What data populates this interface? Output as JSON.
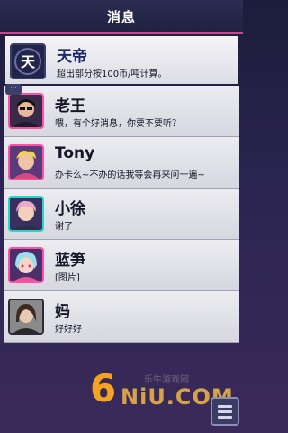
{
  "header": {
    "title": "消息"
  },
  "contacts": [
    {
      "name": "天帝",
      "message": "超出部分按100币/吨计算。",
      "avatar": "tiandi-logo-icon"
    },
    {
      "name": "老王",
      "message": "喂，有个好消息，你要不要听？",
      "avatar": "laowang-avatar",
      "badge": "···"
    },
    {
      "name": "Tony",
      "message": "办卡么~不办的话我等会再来问一遍~",
      "avatar": "tony-avatar"
    },
    {
      "name": "小徐",
      "message": "谢了",
      "avatar": "xiaoxu-avatar"
    },
    {
      "name": "蓝笋",
      "message": "[图片]",
      "avatar": "lansun-avatar"
    },
    {
      "name": "妈",
      "message": "好好好",
      "avatar": "mom-avatar"
    }
  ],
  "watermark": {
    "num": "6",
    "txt": "NiU.COM",
    "cn": "乐牛游戏网"
  },
  "colors": {
    "accent": "#ff4fa8",
    "teal": "#26d7c9",
    "header": "#2b2e52"
  }
}
